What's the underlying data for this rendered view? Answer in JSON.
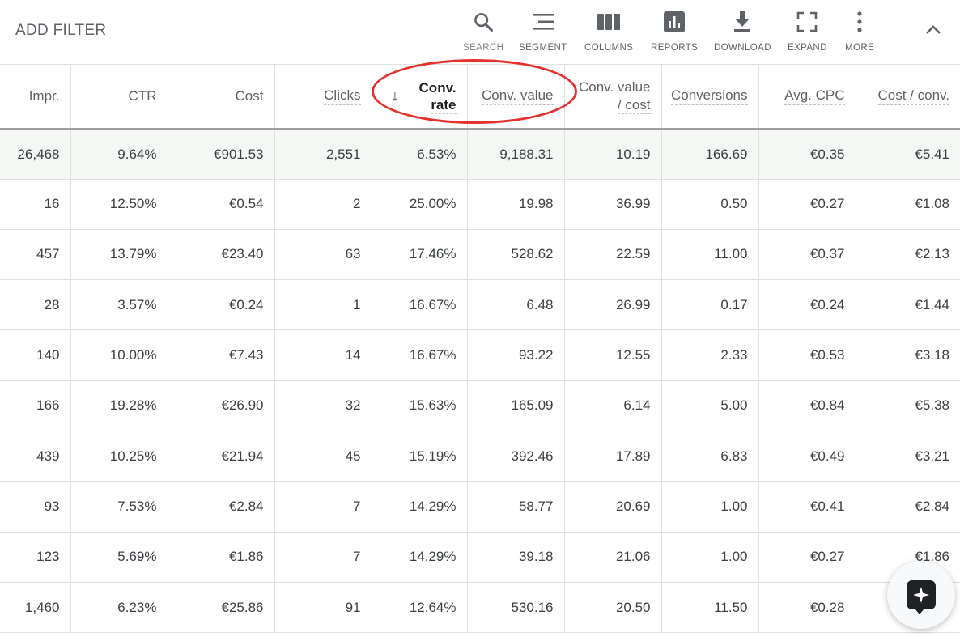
{
  "toolbar": {
    "add_filter": "ADD FILTER",
    "tools": [
      {
        "label": "SEARCH",
        "icon": "search-icon"
      },
      {
        "label": "SEGMENT",
        "icon": "segment-icon"
      },
      {
        "label": "COLUMNS",
        "icon": "columns-icon"
      },
      {
        "label": "REPORTS",
        "icon": "reports-icon"
      },
      {
        "label": "DOWNLOAD",
        "icon": "download-icon"
      },
      {
        "label": "EXPAND",
        "icon": "expand-icon"
      },
      {
        "label": "MORE",
        "icon": "more-vert-icon"
      }
    ],
    "collapse_icon": "chevron-up-icon"
  },
  "table": {
    "headers": [
      {
        "line1": "Impr.",
        "line2": ""
      },
      {
        "line1": "CTR",
        "line2": ""
      },
      {
        "line1": "Cost",
        "line2": ""
      },
      {
        "line1": "Clicks",
        "line2": ""
      },
      {
        "line1": "Conv.",
        "line2": "rate",
        "sort_arrow": "↓"
      },
      {
        "line1": "Conv. value",
        "line2": ""
      },
      {
        "line1": "Conv. value",
        "line2": "/ cost"
      },
      {
        "line1": "Conversions",
        "line2": ""
      },
      {
        "line1": "Avg. CPC",
        "line2": ""
      },
      {
        "line1": "Cost / conv.",
        "line2": ""
      }
    ],
    "total_row": [
      "26,468",
      "9.64%",
      "€901.53",
      "2,551",
      "6.53%",
      "9,188.31",
      "10.19",
      "166.69",
      "€0.35",
      "€5.41"
    ],
    "rows": [
      [
        "16",
        "12.50%",
        "€0.54",
        "2",
        "25.00%",
        "19.98",
        "36.99",
        "0.50",
        "€0.27",
        "€1.08"
      ],
      [
        "457",
        "13.79%",
        "€23.40",
        "63",
        "17.46%",
        "528.62",
        "22.59",
        "11.00",
        "€0.37",
        "€2.13"
      ],
      [
        "28",
        "3.57%",
        "€0.24",
        "1",
        "16.67%",
        "6.48",
        "26.99",
        "0.17",
        "€0.24",
        "€1.44"
      ],
      [
        "140",
        "10.00%",
        "€7.43",
        "14",
        "16.67%",
        "93.22",
        "12.55",
        "2.33",
        "€0.53",
        "€3.18"
      ],
      [
        "166",
        "19.28%",
        "€26.90",
        "32",
        "15.63%",
        "165.09",
        "6.14",
        "5.00",
        "€0.84",
        "€5.38"
      ],
      [
        "439",
        "10.25%",
        "€21.94",
        "45",
        "15.19%",
        "392.46",
        "17.89",
        "6.83",
        "€0.49",
        "€3.21"
      ],
      [
        "93",
        "7.53%",
        "€2.84",
        "7",
        "14.29%",
        "58.77",
        "20.69",
        "1.00",
        "€0.41",
        "€2.84"
      ],
      [
        "123",
        "5.69%",
        "€1.86",
        "7",
        "14.29%",
        "39.18",
        "21.06",
        "1.00",
        "€0.27",
        "€1.86"
      ],
      [
        "1,460",
        "6.23%",
        "€25.86",
        "91",
        "12.64%",
        "530.16",
        "20.50",
        "11.50",
        "€0.28",
        ""
      ]
    ]
  },
  "fab": {
    "icon": "sparkle-chat-icon"
  },
  "annotation": {
    "color": "#e5322f"
  }
}
